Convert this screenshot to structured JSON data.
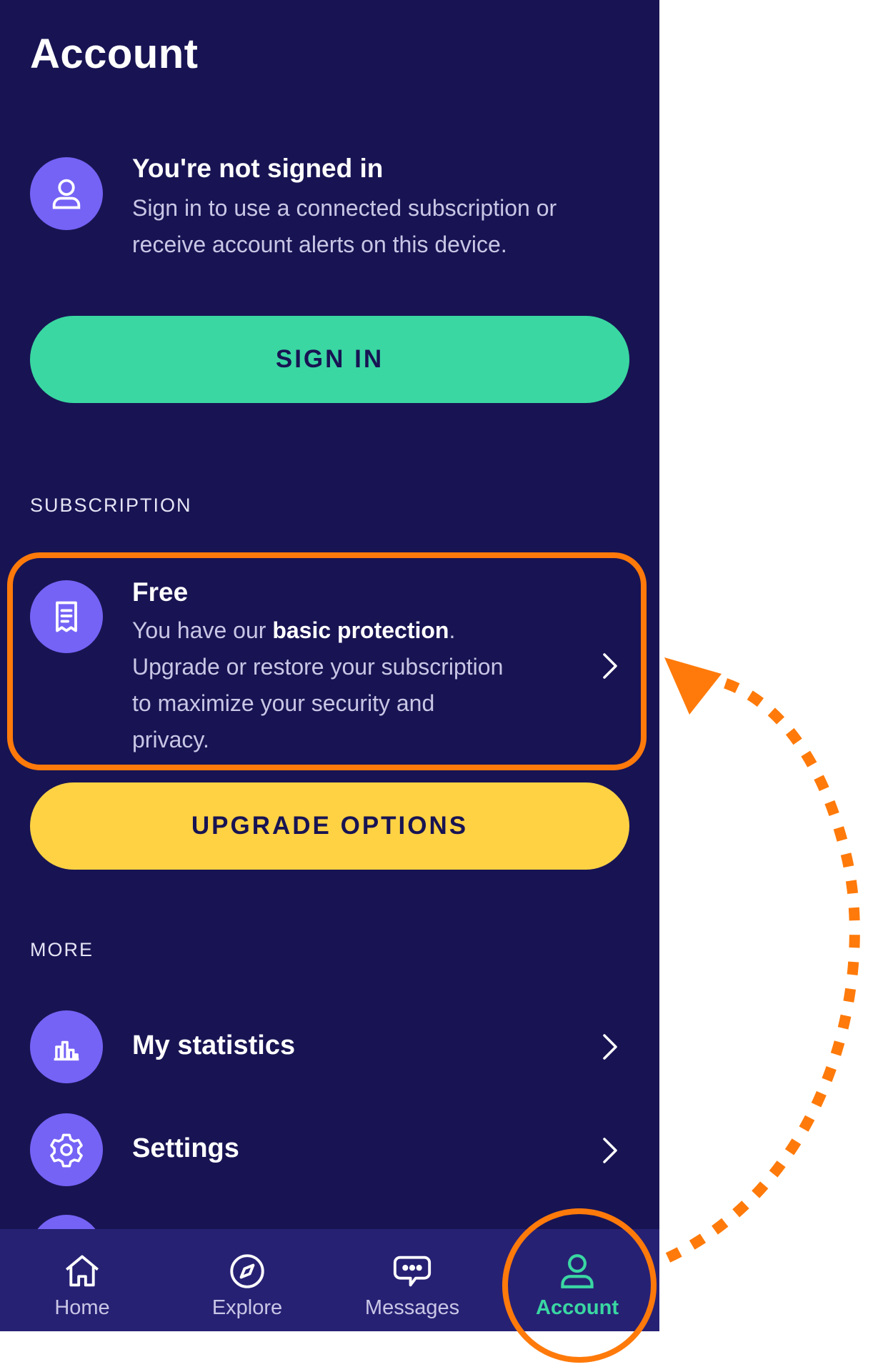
{
  "page": {
    "title": "Account"
  },
  "profile": {
    "title": "You're not signed in",
    "description_line1": "Sign in to use a connected subscription or",
    "description_line2": "receive account alerts on this device."
  },
  "sign_in_button": "SIGN IN",
  "subscription": {
    "section_label": "SUBSCRIPTION",
    "plan_title": "Free",
    "text_pre": "You have our ",
    "text_bold": "basic protection",
    "text_post": ".",
    "line2": "Upgrade or restore your subscription",
    "line3": "to maximize your security and",
    "line4": "privacy."
  },
  "upgrade_button": "UPGRADE OPTIONS",
  "more": {
    "section_label": "MORE",
    "items": [
      {
        "label": "My statistics",
        "icon": "bar-chart-icon"
      },
      {
        "label": "Settings",
        "icon": "gear-icon"
      }
    ]
  },
  "tabs": [
    {
      "label": "Home",
      "icon": "home-icon",
      "active": false
    },
    {
      "label": "Explore",
      "icon": "compass-icon",
      "active": false
    },
    {
      "label": "Messages",
      "icon": "chat-icon",
      "active": false
    },
    {
      "label": "Account",
      "icon": "user-icon",
      "active": true
    }
  ],
  "colors": {
    "background": "#181453",
    "tabbar": "#272174",
    "accent_purple": "#7563f6",
    "sign_in_green": "#3ad7a2",
    "upgrade_yellow": "#fed243",
    "annotation_orange": "#ff7a0a"
  }
}
